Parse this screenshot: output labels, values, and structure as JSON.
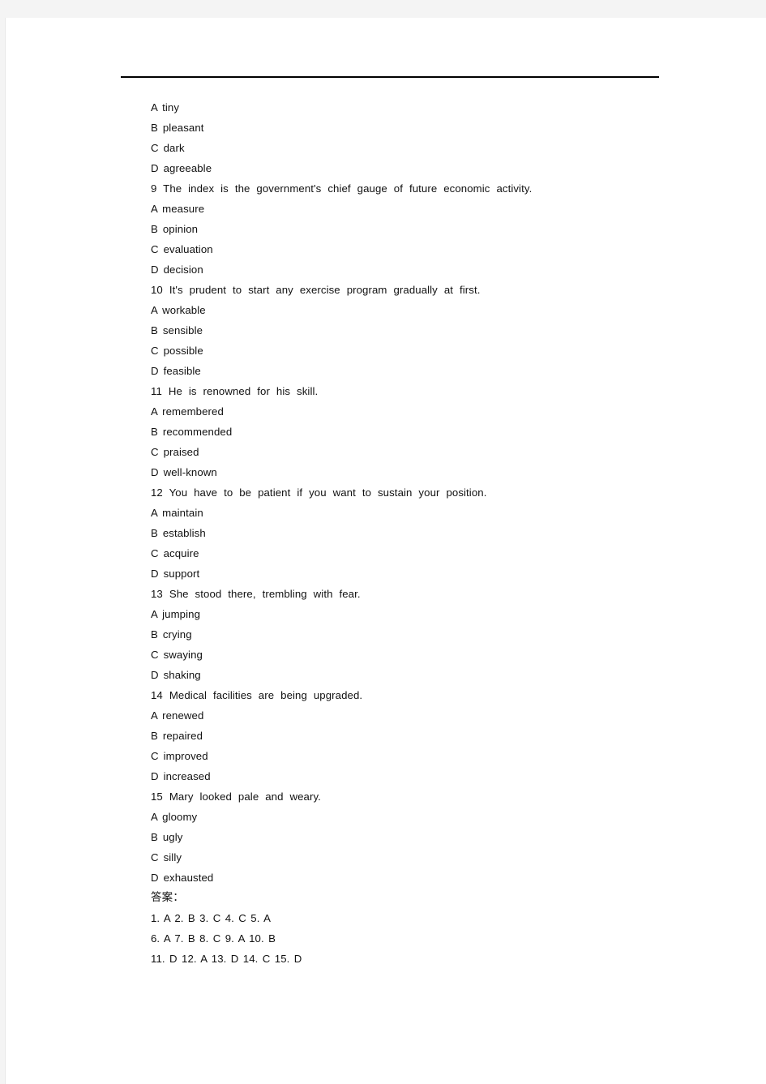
{
  "document": {
    "divider": "horizontal-rule",
    "lines": [
      {
        "kind": "option",
        "text": "A  tiny"
      },
      {
        "kind": "option",
        "text": "B  pleasant"
      },
      {
        "kind": "option",
        "text": "C  dark"
      },
      {
        "kind": "option",
        "text": "D  agreeable"
      },
      {
        "kind": "question",
        "text": "9 The index is the government's chief gauge of future economic activity."
      },
      {
        "kind": "option",
        "text": "A  measure"
      },
      {
        "kind": "option",
        "text": "B  opinion"
      },
      {
        "kind": "option",
        "text": "C  evaluation"
      },
      {
        "kind": "option",
        "text": "D  decision"
      },
      {
        "kind": "question",
        "text": "10 It's prudent to start any exercise program gradually at first."
      },
      {
        "kind": "option",
        "text": "A  workable"
      },
      {
        "kind": "option",
        "text": "B  sensible"
      },
      {
        "kind": "option",
        "text": "C  possible"
      },
      {
        "kind": "option",
        "text": "D  feasible"
      },
      {
        "kind": "question",
        "text": "11 He is renowned for his skill."
      },
      {
        "kind": "option",
        "text": "A  remembered"
      },
      {
        "kind": "option",
        "text": "B  recommended"
      },
      {
        "kind": "option",
        "text": "C  praised"
      },
      {
        "kind": "option",
        "text": "D  well-known"
      },
      {
        "kind": "question",
        "text": "12 You have to be patient if you want to sustain your position."
      },
      {
        "kind": "option",
        "text": "A  maintain"
      },
      {
        "kind": "option",
        "text": "B  establish"
      },
      {
        "kind": "option",
        "text": "C  acquire"
      },
      {
        "kind": "option",
        "text": "D  support"
      },
      {
        "kind": "question",
        "text": "13 She stood there, trembling with fear."
      },
      {
        "kind": "option",
        "text": "A  jumping"
      },
      {
        "kind": "option",
        "text": "B  crying"
      },
      {
        "kind": "option",
        "text": "C  swaying"
      },
      {
        "kind": "option",
        "text": "D  shaking"
      },
      {
        "kind": "question",
        "text": "14 Medical facilities are being upgraded."
      },
      {
        "kind": "option",
        "text": "A  renewed"
      },
      {
        "kind": "option",
        "text": "B  repaired"
      },
      {
        "kind": "option",
        "text": "C  improved"
      },
      {
        "kind": "option",
        "text": "D  increased"
      },
      {
        "kind": "question",
        "text": "15 Mary looked pale and weary."
      },
      {
        "kind": "option",
        "text": "A  gloomy"
      },
      {
        "kind": "option",
        "text": "B  ugly"
      },
      {
        "kind": "option",
        "text": "C  silly"
      },
      {
        "kind": "option",
        "text": "D  exhausted"
      },
      {
        "kind": "cjk",
        "text": "答案："
      },
      {
        "kind": "answers",
        "text": "1. A 2. B 3. C 4. C 5. A"
      },
      {
        "kind": "answers",
        "text": "6. A 7. B 8. C 9. A 10. B"
      },
      {
        "kind": "answers",
        "text": "11. D 12. A 13. D 14. C 15. D"
      }
    ]
  }
}
